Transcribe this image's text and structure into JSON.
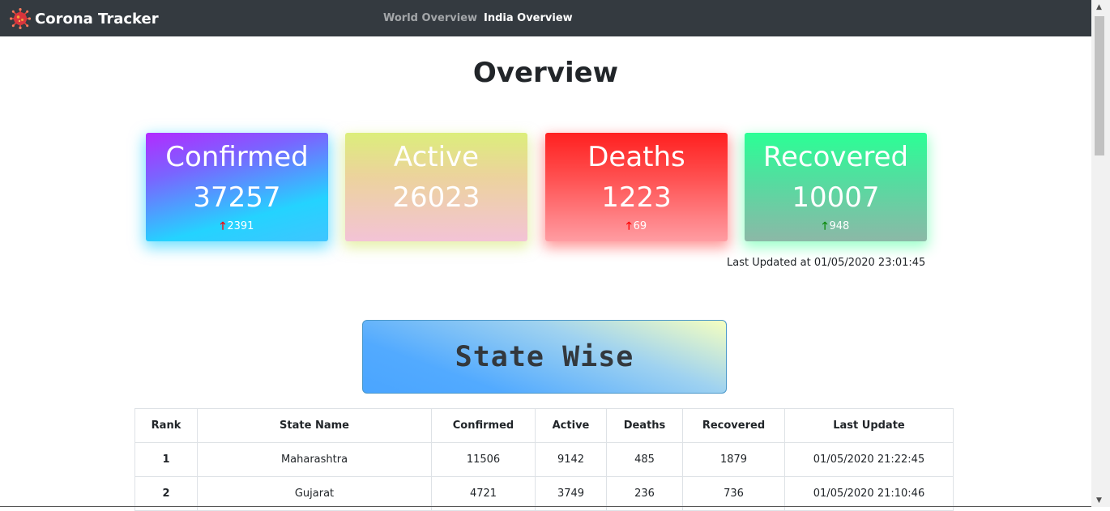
{
  "navbar": {
    "brand": "Corona Tracker",
    "links": [
      "World Overview",
      "India Overview"
    ],
    "active_link": "India Overview"
  },
  "page": {
    "title": "Overview"
  },
  "cards": {
    "confirmed": {
      "label": "Confirmed",
      "value": "37257",
      "delta": "2391",
      "delta_direction": "up",
      "arrow_color": "#ff0000"
    },
    "active": {
      "label": "Active",
      "value": "26023"
    },
    "deaths": {
      "label": "Deaths",
      "value": "1223",
      "delta": "69",
      "delta_direction": "up",
      "arrow_color": "#ff0000"
    },
    "recovered": {
      "label": "Recovered",
      "value": "10007",
      "delta": "948",
      "delta_direction": "up",
      "arrow_color": "#0a8a0a"
    }
  },
  "last_updated": "Last Updated at 01/05/2020 23:01:45",
  "state_wise_button": "State Wise",
  "table": {
    "headers": [
      "Rank",
      "State Name",
      "Confirmed",
      "Active",
      "Deaths",
      "Recovered",
      "Last Update"
    ],
    "rows": [
      [
        "1",
        "Maharashtra",
        "11506",
        "9142",
        "485",
        "1879",
        "01/05/2020 21:22:45"
      ],
      [
        "2",
        "Gujarat",
        "4721",
        "3749",
        "236",
        "736",
        "01/05/2020 21:10:46"
      ]
    ]
  },
  "icons": {
    "brand": "coronavirus-icon",
    "delta_arrow": "arrow-up-icon"
  }
}
